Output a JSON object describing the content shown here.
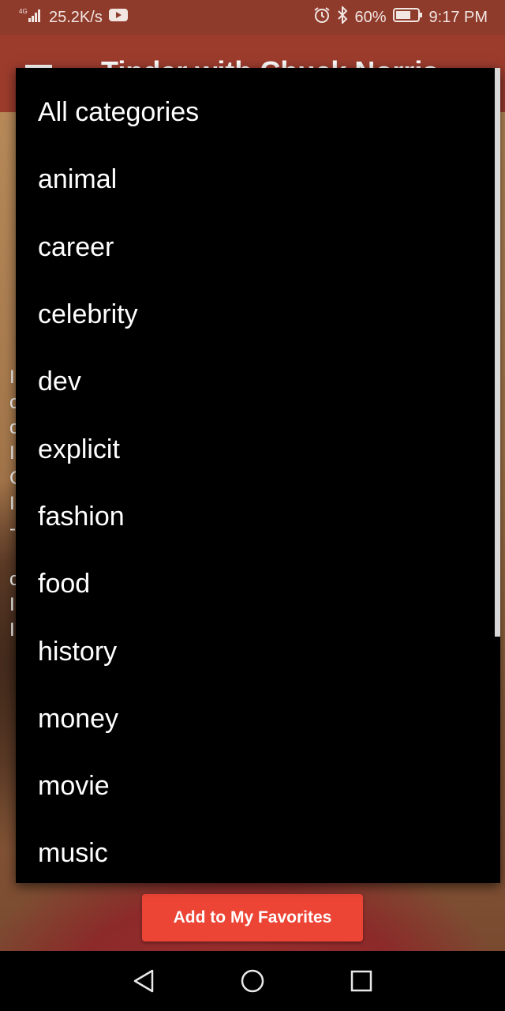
{
  "status_bar": {
    "network_type": "4G",
    "speed": "25.2K/s",
    "battery_percent": "60%",
    "time": "9:17 PM"
  },
  "app_bar": {
    "title": "Tinder with Chuck Norris"
  },
  "dropdown": {
    "items": [
      "All categories",
      "animal",
      "career",
      "celebrity",
      "dev",
      "explicit",
      "fashion",
      "food",
      "history",
      "money",
      "movie",
      "music"
    ]
  },
  "actions": {
    "favorites_label": "Add to My Favorites"
  },
  "colors": {
    "app_bar": "#9c3c2d",
    "status_bar": "#8f3b2c",
    "button": "#ec4536",
    "menu_background": "#000000"
  }
}
